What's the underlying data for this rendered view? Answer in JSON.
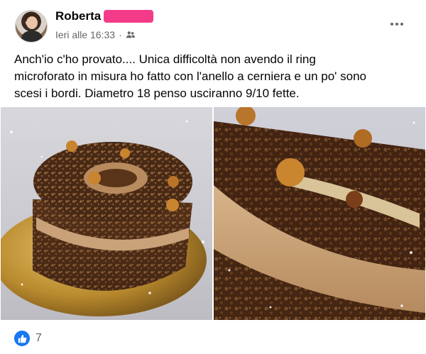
{
  "post": {
    "author": {
      "name": "Roberta"
    },
    "timestamp": "Ieri alle 16:33",
    "separator": "·",
    "audience_icon": "friends-icon",
    "more_icon": "more-horizontal-icon",
    "text_lines": [
      "Anch'io c'ho provato.... Unica difficoltà non avendo il ring",
      "microforato in misura ho fatto con l'anello a cerniera e un po' sono",
      "scesi i bordi.  Diametro 18 penso usciranno 9/10 fette."
    ],
    "photos": [
      {
        "subject": "cake-photo-icon"
      },
      {
        "subject": "cake-photo-icon"
      }
    ],
    "reactions": {
      "icon": "thumbs-up-icon",
      "count": "7"
    }
  },
  "colors": {
    "accent": "#1877f2",
    "secondary_text": "#65676b",
    "redaction": "#f43b8a"
  }
}
